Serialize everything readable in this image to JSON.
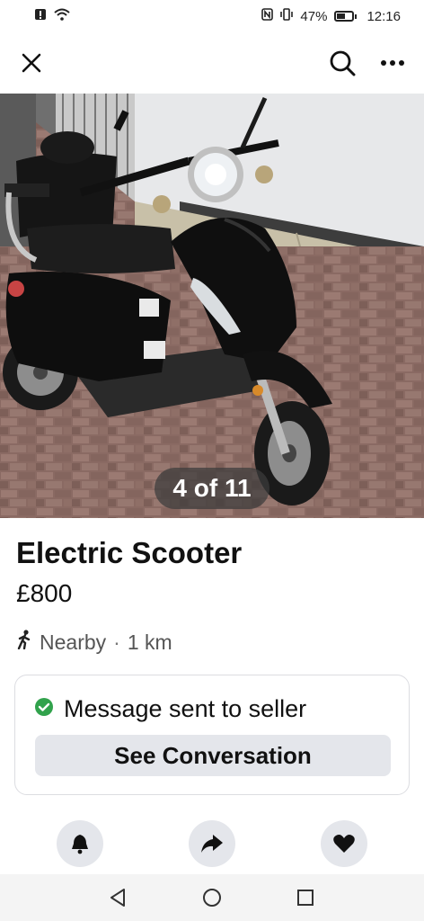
{
  "status_bar": {
    "battery_percent": "47%",
    "time": "12:16",
    "icons": [
      "alert-icon",
      "wifi-icon",
      "nfc-icon",
      "vibrate-icon",
      "battery-icon"
    ]
  },
  "header": {
    "icons": [
      "close-icon",
      "search-icon",
      "more-icon"
    ]
  },
  "gallery": {
    "counter": "4 of 11"
  },
  "listing": {
    "title": "Electric Scooter",
    "price": "£800",
    "location": "Nearby",
    "separator": "·",
    "distance": "1 km"
  },
  "message": {
    "status": "Message sent to seller",
    "button_label": "See Conversation",
    "accent_color": "#31a24c"
  },
  "actions": {
    "icons": [
      "bell-icon",
      "share-icon",
      "heart-icon"
    ]
  },
  "nav": {
    "icons": [
      "back-icon",
      "home-icon",
      "recents-icon"
    ]
  }
}
